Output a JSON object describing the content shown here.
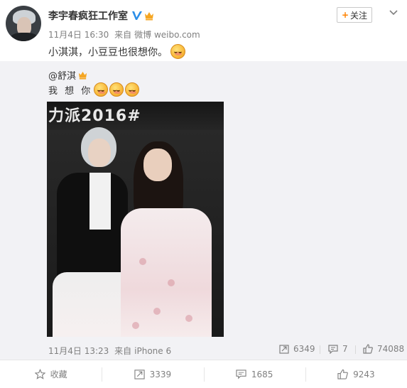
{
  "post": {
    "author": "李宇春疯狂工作室",
    "time": "11月4日 16:30",
    "source_prefix": "来自",
    "source": "微博 weibo.com",
    "text": "小淇淇，小豆豆也很想你。",
    "follow_label": "关注"
  },
  "repost": {
    "author": "@舒淇",
    "text": "我 想 你",
    "image_banner_text": "力派2016#",
    "time": "11月4日 13:23",
    "source_prefix": "来自",
    "source": "iPhone 6",
    "reposts": "6349",
    "comments": "7",
    "likes": "74088"
  },
  "actions": {
    "favorite_label": "收藏",
    "repost_count": "3339",
    "comment_count": "1685",
    "like_count": "9243"
  },
  "colors": {
    "accent": "#ff8200",
    "verified": "#2b8ee8",
    "muted": "#808080",
    "repost_bg": "#f2f2f5"
  }
}
